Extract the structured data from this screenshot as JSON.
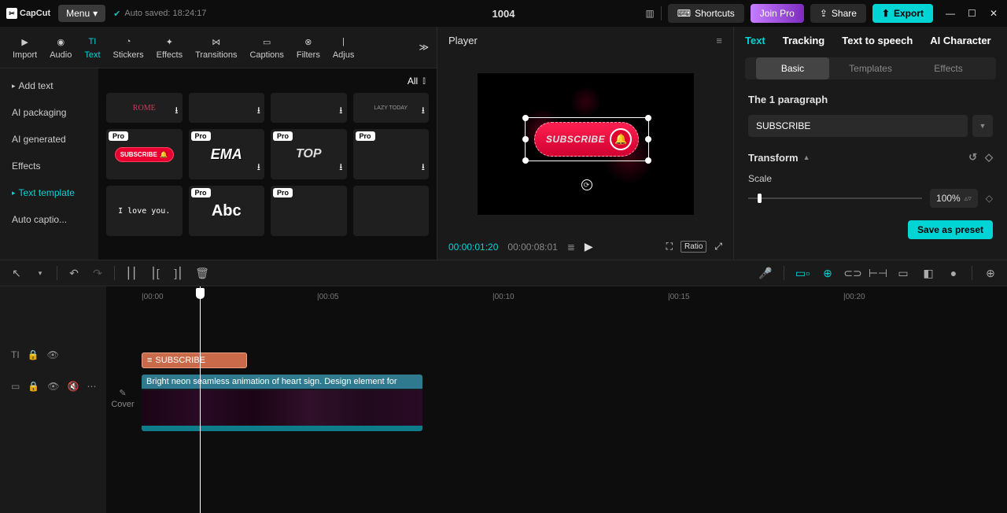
{
  "app": {
    "name": "CapCut",
    "menu": "Menu",
    "autosave": "Auto saved: 18:24:17",
    "title": "1004"
  },
  "topbar": {
    "shortcuts": "Shortcuts",
    "join_pro": "Join Pro",
    "share": "Share",
    "export": "Export"
  },
  "tabs": {
    "import": "Import",
    "audio": "Audio",
    "text": "Text",
    "stickers": "Stickers",
    "effects": "Effects",
    "transitions": "Transitions",
    "captions": "Captions",
    "filters": "Filters",
    "adjust": "Adjus"
  },
  "sidebar": {
    "add_text": "Add text",
    "ai_packaging": "AI packaging",
    "ai_generated": "AI generated",
    "effects": "Effects",
    "text_template": "Text template",
    "auto_captions": "Auto captio..."
  },
  "grid": {
    "all": "All",
    "items": [
      "ROME",
      "",
      "",
      "LAZY TODAY",
      "SUBSCRIBE",
      "EMA",
      "TOP",
      "",
      "I love you.",
      "Abc",
      "",
      ""
    ]
  },
  "player": {
    "title": "Player",
    "subscribe": "SUBSCRIBE",
    "time_current": "00:00:01:20",
    "time_total": "00:00:08:01",
    "ratio": "Ratio"
  },
  "right": {
    "tabs": {
      "text": "Text",
      "tracking": "Tracking",
      "tts": "Text to speech",
      "ai_char": "AI Character"
    },
    "subtabs": {
      "basic": "Basic",
      "templates": "Templates",
      "effects": "Effects"
    },
    "paragraph_title": "The 1 paragraph",
    "text_value": "SUBSCRIBE",
    "transform": "Transform",
    "scale_label": "Scale",
    "scale_value": "100%",
    "save_preset": "Save as preset"
  },
  "timeline": {
    "ticks": [
      "|00:00",
      "|00:05",
      "|00:10",
      "|00:15",
      "|00:20"
    ],
    "text_clip": "SUBSCRIBE",
    "video_clip": "Bright neon seamless animation of heart sign. Design element for",
    "cover": "Cover"
  }
}
